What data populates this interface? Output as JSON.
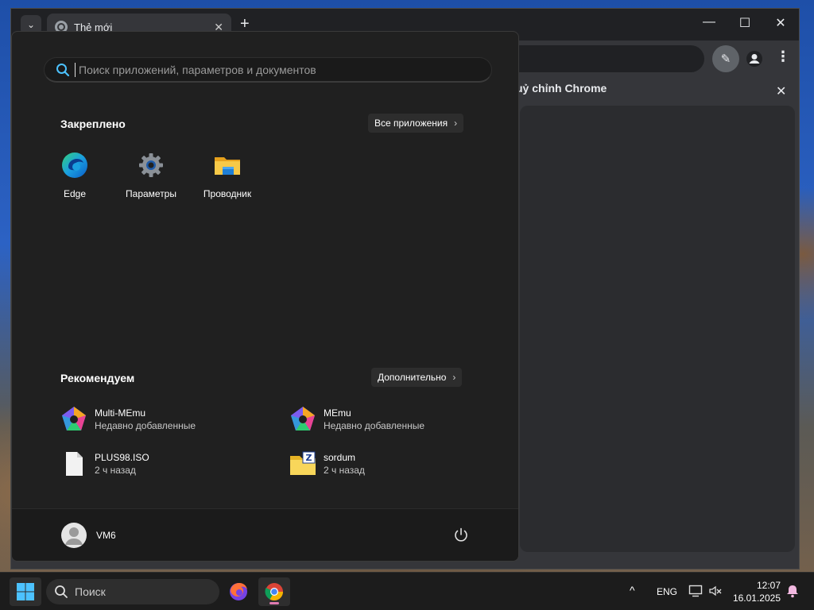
{
  "chrome": {
    "tab_title": "Thẻ mới",
    "side_panel_title": "uỷ chỉnh Chrome",
    "close_glyph": "✕",
    "new_tab_glyph": "+",
    "minimize_glyph": "—",
    "maximize_glyph": "☐",
    "window_close_glyph": "✕",
    "kebab_glyph": "⋮",
    "dropdown_glyph": "⌄",
    "pen_glyph": "✎"
  },
  "start_menu": {
    "search_placeholder": "Поиск приложений, параметров и документов",
    "pinned": {
      "title": "Закреплено",
      "all_apps_label": "Все приложения",
      "apps": [
        {
          "label": "Edge",
          "icon": "edge-icon"
        },
        {
          "label": "Параметры",
          "icon": "settings-gear-icon"
        },
        {
          "label": "Проводник",
          "icon": "file-explorer-icon"
        }
      ]
    },
    "recommended": {
      "title": "Рекомендуем",
      "more_label": "Дополнительно",
      "items": [
        {
          "name": "Multi-MEmu",
          "sub": "Недавно добавленные",
          "icon": "memu-icon"
        },
        {
          "name": "MEmu",
          "sub": "Недавно добавленные",
          "icon": "memu-icon"
        },
        {
          "name": "PLUS98.ISO",
          "sub": "2 ч назад",
          "icon": "file-icon"
        },
        {
          "name": "sordum",
          "sub": "2 ч назад",
          "icon": "folder-icon"
        }
      ]
    },
    "user": {
      "name": "VM6"
    },
    "chevron": "›"
  },
  "taskbar": {
    "search_label": "Поиск",
    "language": "ENG",
    "tray_chevron": "^",
    "time": "12:07",
    "date": "16.01.2025"
  },
  "colors": {
    "accent": "#4cc2ff",
    "menu_bg": "#202020",
    "taskbar_bg": "#1c1c1c"
  }
}
